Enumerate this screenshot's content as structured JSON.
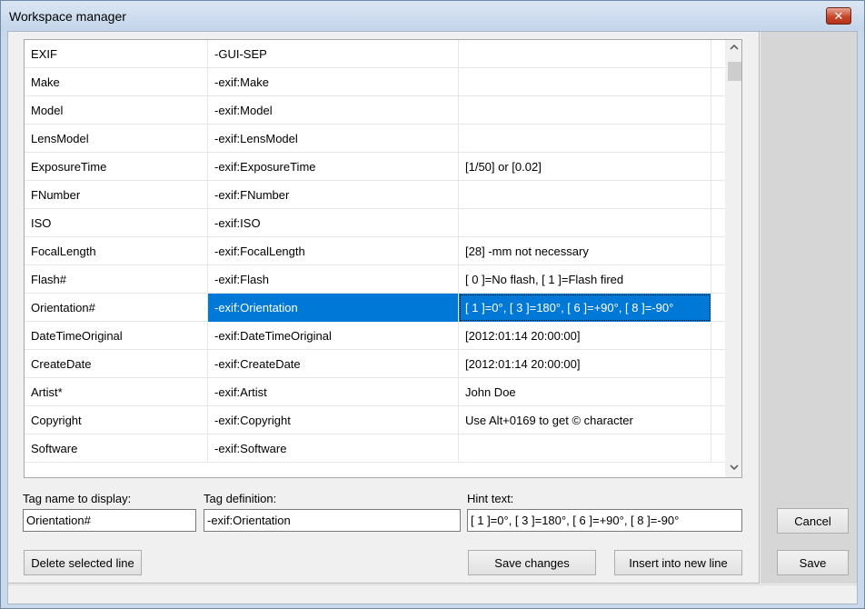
{
  "window": {
    "title": "Workspace manager",
    "close_label": "✕"
  },
  "table": {
    "rows": [
      {
        "name": "EXIF",
        "definition": "-GUI-SEP",
        "hint": ""
      },
      {
        "name": "Make",
        "definition": "-exif:Make",
        "hint": ""
      },
      {
        "name": "Model",
        "definition": "-exif:Model",
        "hint": ""
      },
      {
        "name": "LensModel",
        "definition": "-exif:LensModel",
        "hint": ""
      },
      {
        "name": "ExposureTime",
        "definition": "-exif:ExposureTime",
        "hint": "[1/50] or [0.02]"
      },
      {
        "name": "FNumber",
        "definition": "-exif:FNumber",
        "hint": ""
      },
      {
        "name": "ISO",
        "definition": "-exif:ISO",
        "hint": ""
      },
      {
        "name": "FocalLength",
        "definition": "-exif:FocalLength",
        "hint": "[28] -mm not necessary"
      },
      {
        "name": "Flash#",
        "definition": "-exif:Flash",
        "hint": "[ 0 ]=No flash, [ 1 ]=Flash fired"
      },
      {
        "name": "Orientation#",
        "definition": "-exif:Orientation",
        "hint": "[ 1 ]=0°, [ 3 ]=180°, [ 6 ]=+90°, [ 8 ]=-90°",
        "selected": true
      },
      {
        "name": "DateTimeOriginal",
        "definition": "-exif:DateTimeOriginal",
        "hint": "[2012:01:14 20:00:00]"
      },
      {
        "name": "CreateDate",
        "definition": "-exif:CreateDate",
        "hint": "[2012:01:14 20:00:00]"
      },
      {
        "name": "Artist*",
        "definition": "-exif:Artist",
        "hint": "John Doe"
      },
      {
        "name": "Copyright",
        "definition": "-exif:Copyright",
        "hint": "Use Alt+0169 to get © character"
      },
      {
        "name": "Software",
        "definition": "-exif:Software",
        "hint": ""
      }
    ]
  },
  "form": {
    "tag_name_label": "Tag name to display:",
    "tag_name_value": "Orientation#",
    "tag_def_label": "Tag definition:",
    "tag_def_value": "-exif:Orientation",
    "hint_label": "Hint text:",
    "hint_value": "[ 1 ]=0°, [ 3 ]=180°, [ 6 ]=+90°, [ 8 ]=-90°"
  },
  "buttons": {
    "delete": "Delete selected line",
    "save_changes": "Save changes",
    "insert": "Insert into new line",
    "cancel": "Cancel",
    "save": "Save"
  },
  "colors": {
    "selection": "#0078d7",
    "close_button": "#c7472a"
  },
  "icons": {
    "scroll_up": "chevron-up-icon",
    "scroll_down": "chevron-down-icon",
    "close": "close-icon"
  }
}
